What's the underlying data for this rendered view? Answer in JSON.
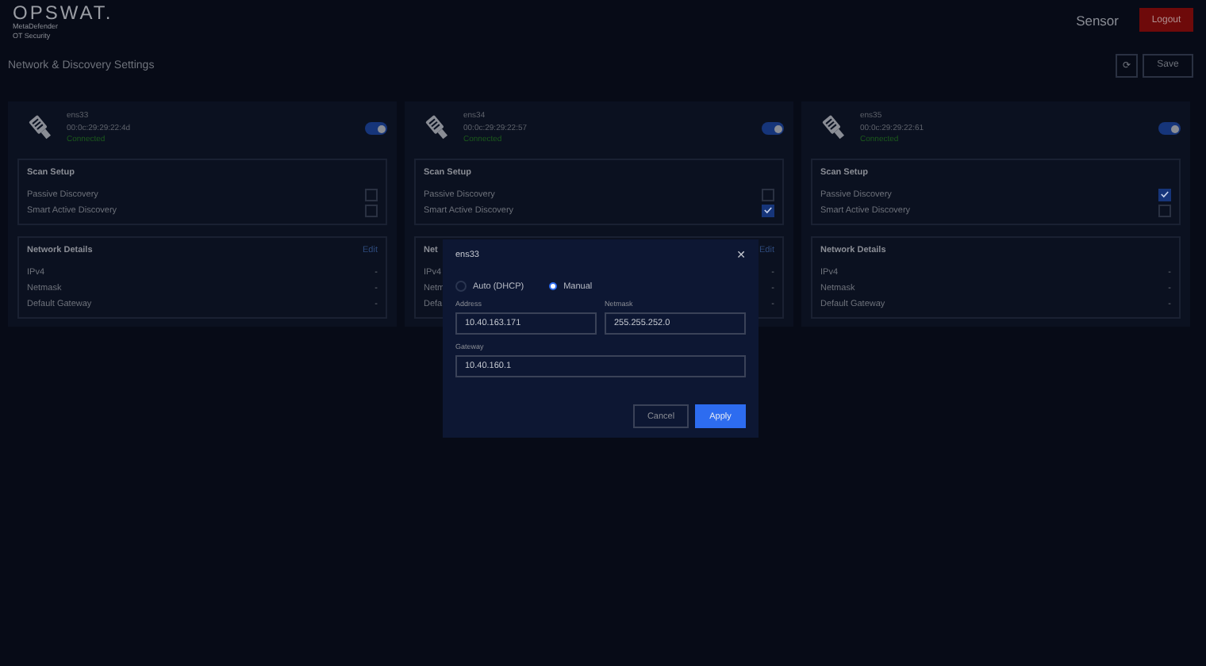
{
  "header": {
    "logo": "OPSWAT.",
    "product_line_1": "MetaDefender",
    "product_line_2": "OT Security",
    "user": "Sensor",
    "logout": "Logout"
  },
  "page": {
    "title": "Network & Discovery Settings",
    "refresh_icon": "⟳",
    "save": "Save"
  },
  "interfaces": [
    {
      "name": "ens33",
      "mac": "00:0c:29:29:22:4d",
      "status": "Connected",
      "enabled": true,
      "scan_title": "Scan Setup",
      "options": [
        {
          "label": "Passive Discovery",
          "checked": false
        },
        {
          "label": "Smart Active Discovery",
          "checked": false
        }
      ],
      "details_title": "Network Details",
      "edit": "Edit",
      "details": [
        {
          "label": "IPv4",
          "value": "-"
        },
        {
          "label": "Netmask",
          "value": "-"
        },
        {
          "label": "Default Gateway",
          "value": "-"
        }
      ]
    },
    {
      "name": "ens34",
      "mac": "00:0c:29:29:22:57",
      "status": "Connected",
      "enabled": true,
      "scan_title": "Scan Setup",
      "options": [
        {
          "label": "Passive Discovery",
          "checked": false
        },
        {
          "label": "Smart Active Discovery",
          "checked": true
        }
      ],
      "details_title": "Net",
      "edit": "Edit",
      "details": [
        {
          "label": "IPv4",
          "value": "-"
        },
        {
          "label": "Netm",
          "value": "-"
        },
        {
          "label": "Defa",
          "value": "-"
        }
      ]
    },
    {
      "name": "ens35",
      "mac": "00:0c:29:29:22:61",
      "status": "Connected",
      "enabled": true,
      "scan_title": "Scan Setup",
      "options": [
        {
          "label": "Passive Discovery",
          "checked": true
        },
        {
          "label": "Smart Active Discovery",
          "checked": false
        }
      ],
      "details_title": "Network Details",
      "details": [
        {
          "label": "IPv4",
          "value": "-"
        },
        {
          "label": "Netmask",
          "value": "-"
        },
        {
          "label": "Default Gateway",
          "value": "-"
        }
      ]
    }
  ],
  "dialog": {
    "title": "ens33",
    "close": "✕",
    "modes": [
      {
        "label": "Auto (DHCP)",
        "selected": false
      },
      {
        "label": "Manual",
        "selected": true
      }
    ],
    "fields": [
      {
        "label": "Address",
        "value": "10.40.163.171"
      },
      {
        "label": "Netmask",
        "value": "255.255.252.0"
      },
      {
        "label": "Gateway",
        "value": "10.40.160.1"
      }
    ],
    "cancel": "Cancel",
    "apply": "Apply"
  }
}
